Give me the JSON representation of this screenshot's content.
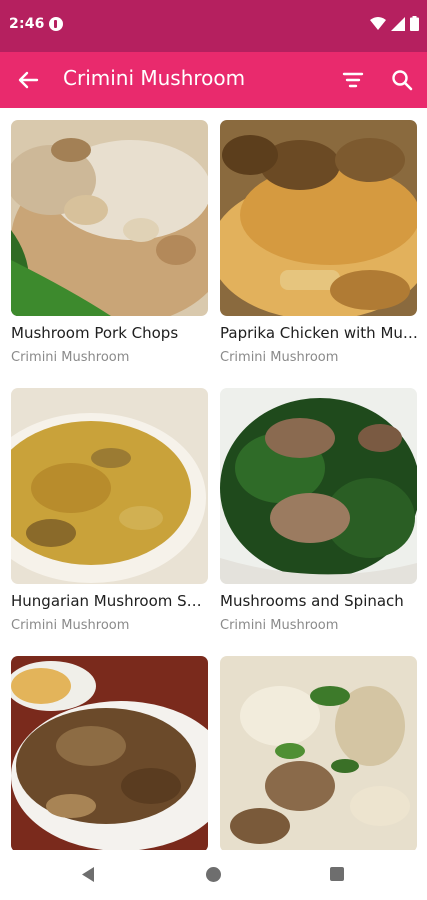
{
  "status_bar": {
    "time": "2:46"
  },
  "app_bar": {
    "title": "Crimini Mushroom",
    "icons": [
      "back-arrow-icon",
      "filter-icon",
      "search-icon"
    ],
    "color": "#e92a6d"
  },
  "recipes": [
    {
      "title": "Mushroom Pork Chops",
      "category": "Crimini Mushroom"
    },
    {
      "title": "Paprika Chicken with Mushrooms",
      "category": "Crimini Mushroom"
    },
    {
      "title": "Hungarian Mushroom Soup",
      "category": "Crimini Mushroom"
    },
    {
      "title": "Mushrooms and Spinach",
      "category": "Crimini Mushroom"
    },
    {
      "title": "",
      "category": ""
    },
    {
      "title": "",
      "category": ""
    }
  ],
  "nav_bar": {
    "icons": [
      "back-triangle-icon",
      "home-circle-icon",
      "recents-square-icon"
    ]
  }
}
